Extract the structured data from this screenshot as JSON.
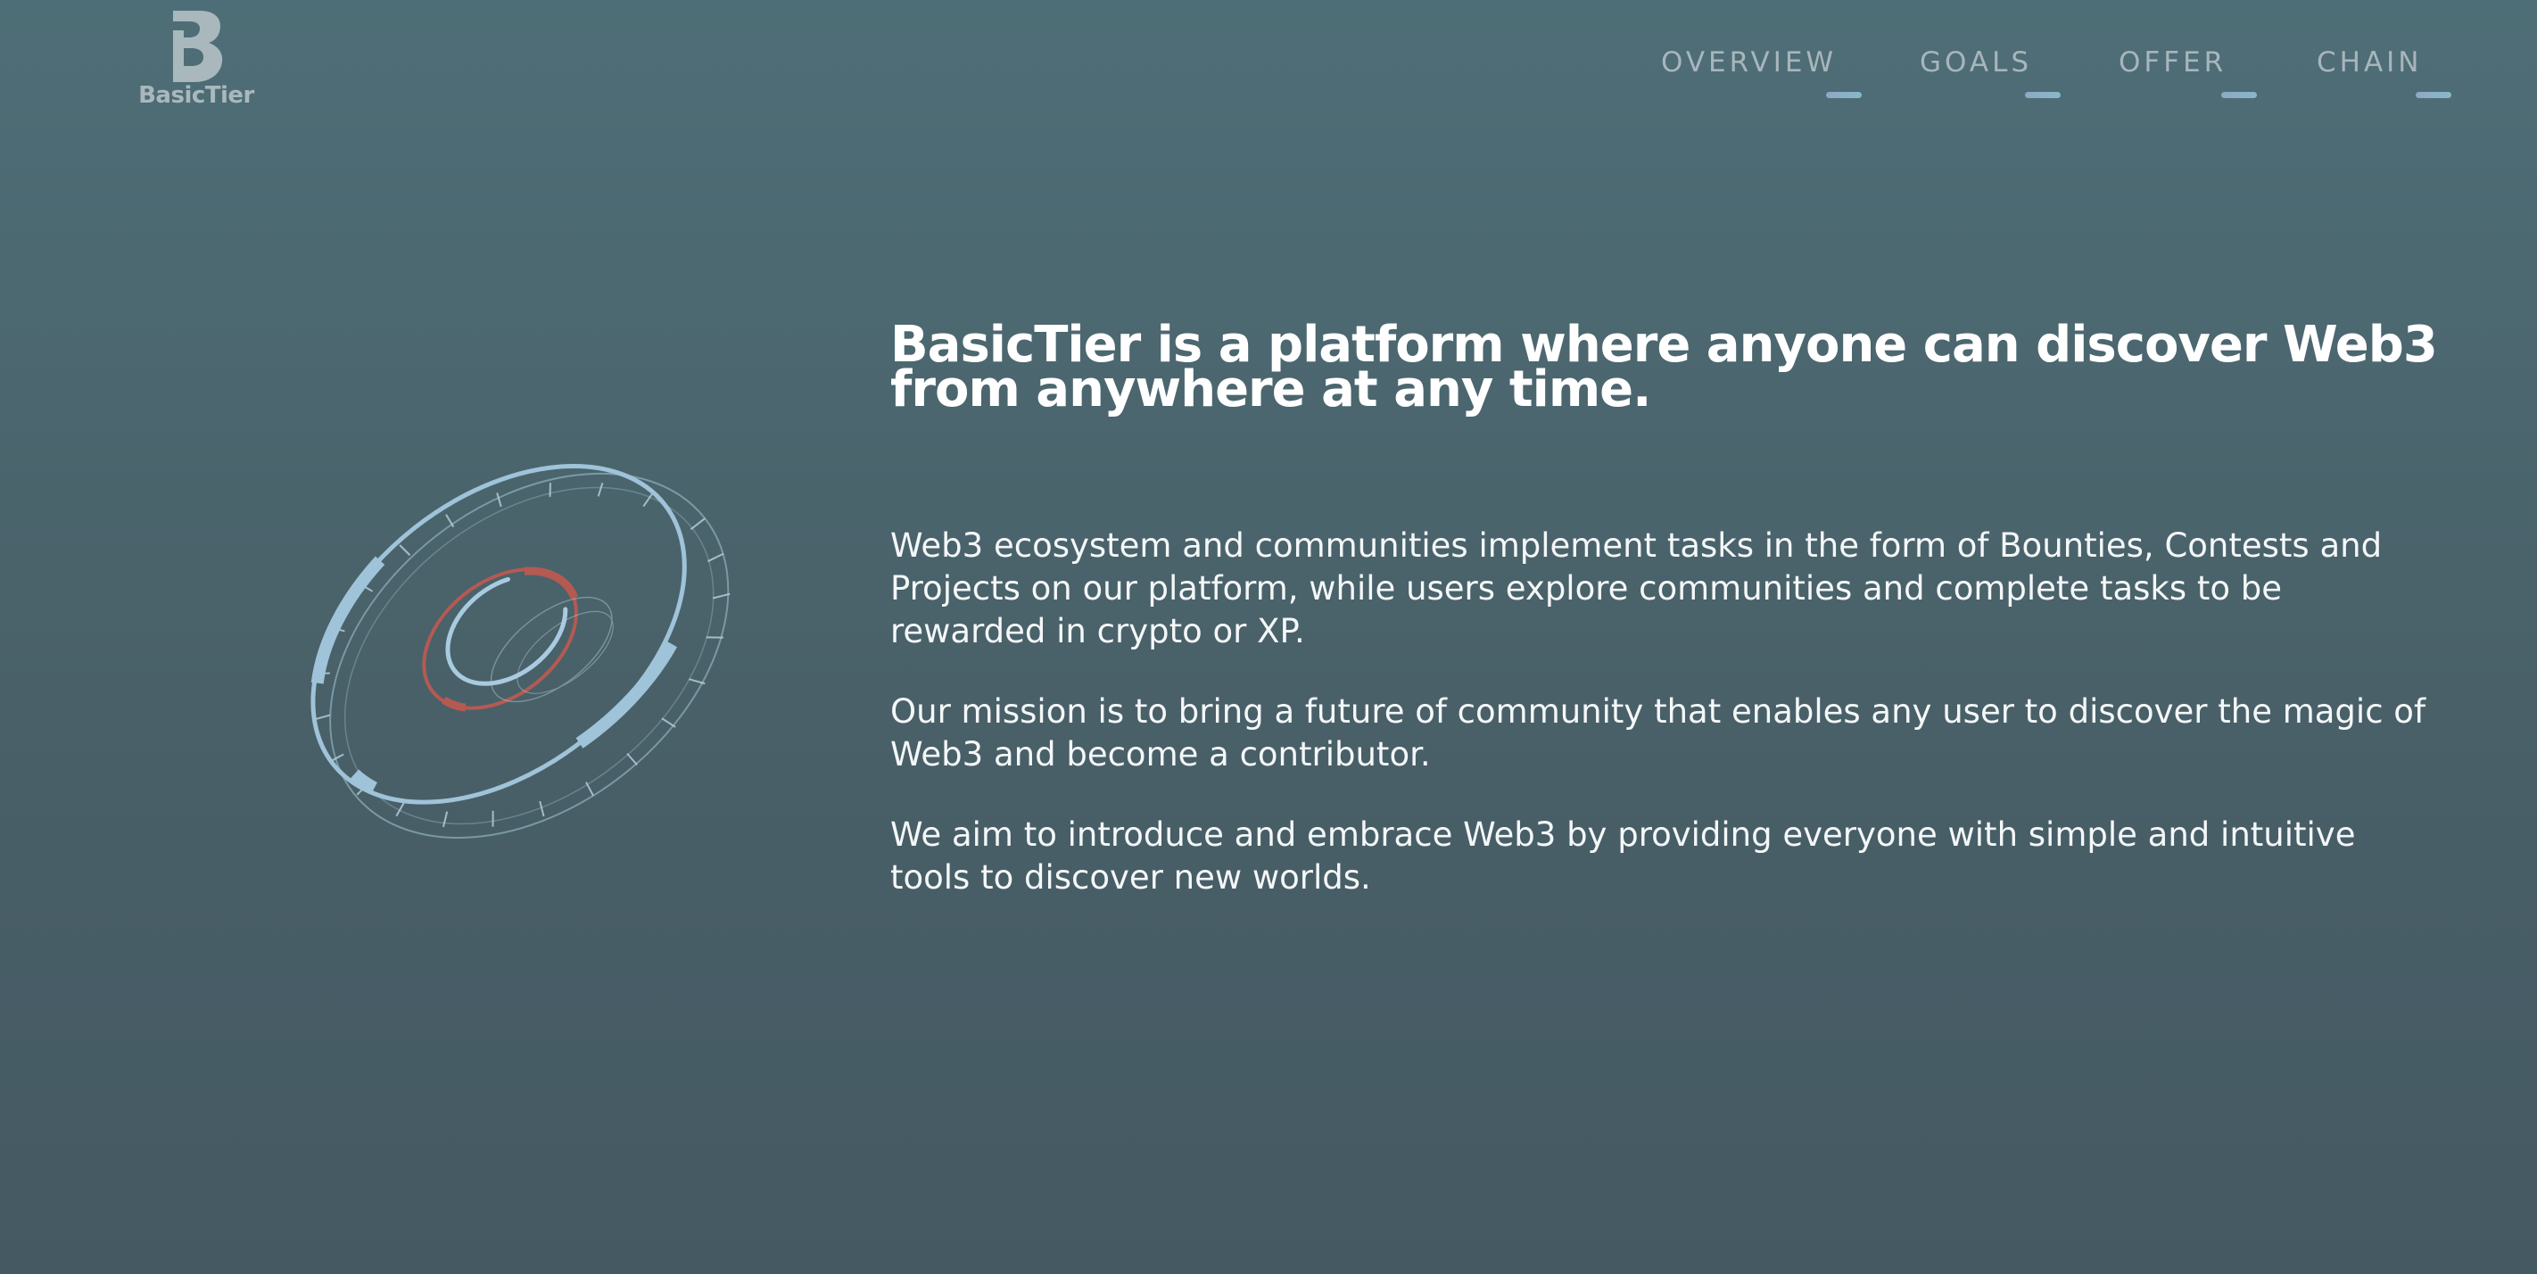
{
  "brand": {
    "name": "BasicTier",
    "logo_icon": "basictier-b-logo-icon",
    "logo_color": "#a9b8bd"
  },
  "nav": {
    "items": [
      {
        "label": "OVERVIEW"
      },
      {
        "label": "GOALS"
      },
      {
        "label": "OFFER"
      },
      {
        "label": "CHAIN"
      }
    ],
    "text_color": "#a7b6bc",
    "underline_color": "#8fa7c4"
  },
  "hero": {
    "graphic_icon": "orbital-dial-icon",
    "ring_color": "#9fc3d8",
    "accent_color": "#b45a53",
    "headline": "BasicTier is a platform where anyone can discover Web3 from anywhere at any time.",
    "paragraphs": [
      "Web3 ecosystem and communities implement tasks in the form of Bounties, Contests and Projects on our platform, while users explore communities and complete tasks to be rewarded in crypto or XP.",
      "Our mission is to bring a future of community that enables any user to discover the magic of Web3 and become a contributor.",
      "We aim to introduce and embrace Web3 by providing everyone with simple and intuitive tools to discover new worlds."
    ]
  },
  "theme": {
    "background_top": "#4e6e77",
    "background_bottom": "#455963",
    "text_color": "#ffffff"
  }
}
